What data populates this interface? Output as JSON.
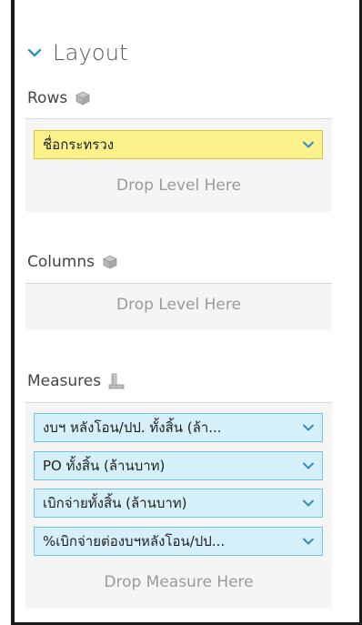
{
  "layout": {
    "title": "Layout"
  },
  "rows": {
    "label": "Rows",
    "items": [
      {
        "label": "ชื่อกระทรวง"
      }
    ],
    "drop_text": "Drop Level Here"
  },
  "columns": {
    "label": "Columns",
    "drop_text": "Drop Level Here"
  },
  "measures": {
    "label": "Measures",
    "items": [
      {
        "label": "งบฯ หลังโอน/ปป. ทั้งสิ้น (ล้า..."
      },
      {
        "label": "PO ทั้งสิ้น (ล้านบาท)"
      },
      {
        "label": "เบิกจ่ายทั้งสิ้น (ล้านบาท)"
      },
      {
        "label": "%เบิกจ่ายต่องบฯหลังโอน/ปป..."
      }
    ],
    "drop_text": "Drop Measure Here"
  },
  "colors": {
    "accent": "#2f8fc4",
    "measure_fill": "#d6f0fa",
    "measure_border": "#6cc6e6",
    "row_fill": "#fbf28c",
    "row_border": "#d8c93c"
  }
}
